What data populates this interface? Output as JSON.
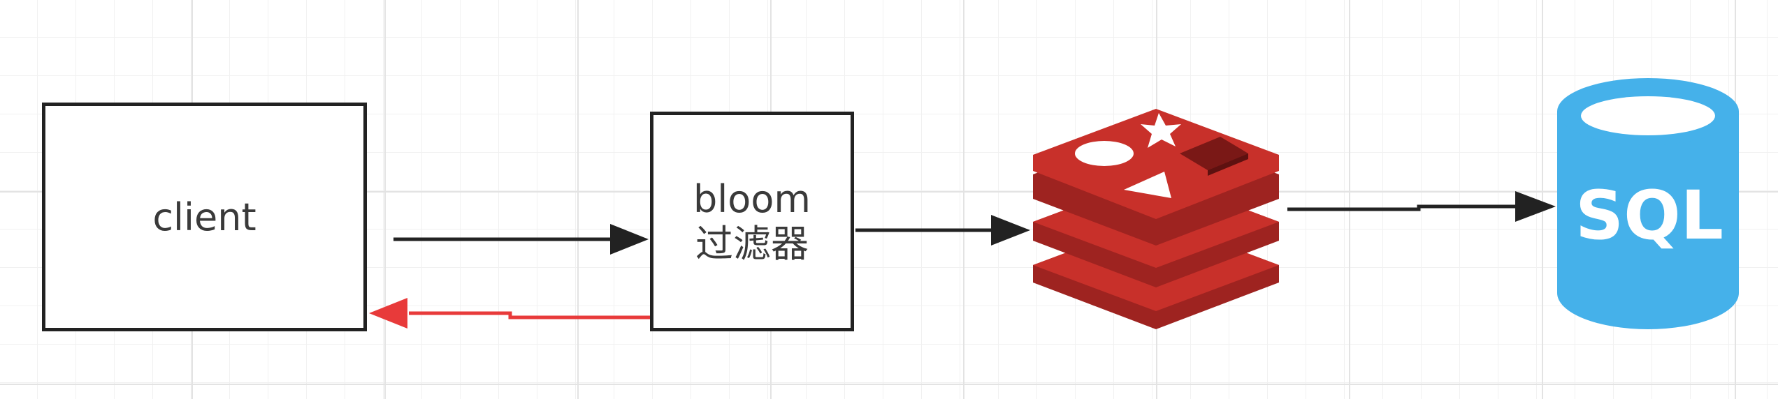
{
  "diagram": {
    "nodes": {
      "client": {
        "label": "client"
      },
      "bloom_filter": {
        "label_line1": "bloom",
        "label_line2": "过滤器"
      },
      "cache": {
        "icon": "redis-icon"
      },
      "database": {
        "icon": "database-cylinder-icon",
        "label": "SQL"
      }
    },
    "edges": [
      {
        "from": "client",
        "to": "bloom_filter",
        "color": "#222222"
      },
      {
        "from": "bloom_filter",
        "to": "client",
        "color": "#e83a3a"
      },
      {
        "from": "bloom_filter",
        "to": "cache",
        "color": "#222222"
      },
      {
        "from": "cache",
        "to": "database",
        "color": "#222222"
      }
    ],
    "colors": {
      "redis_red": "#c8302a",
      "redis_dark": "#9e2320",
      "sql_blue": "#45b1ea",
      "grid": "#e3e3e3"
    }
  }
}
